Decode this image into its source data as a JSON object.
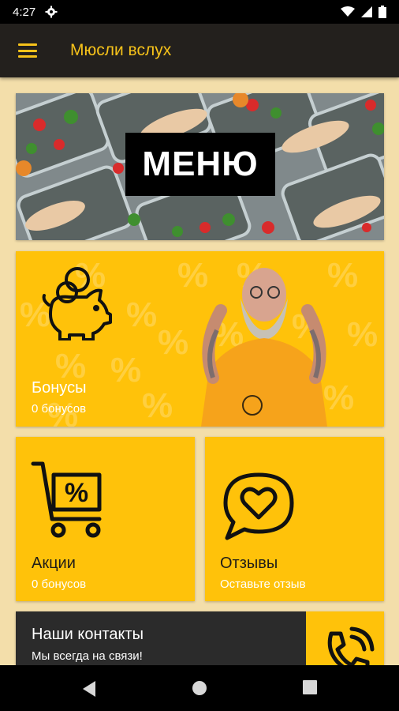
{
  "status": {
    "time": "4:27"
  },
  "appbar": {
    "title": "Мюсли вслух",
    "menu_icon": "hamburger-icon"
  },
  "menu_card": {
    "label": "МЕНЮ"
  },
  "bonus_card": {
    "title": "Бонусы",
    "subtitle": "0 бонусов",
    "icon": "piggy-bank-icon"
  },
  "promo_card": {
    "title": "Акции",
    "subtitle": "0 бонусов",
    "icon": "shopping-cart-percent-icon"
  },
  "review_card": {
    "title": "Отзывы",
    "subtitle": "Оставьте отзыв",
    "icon": "heart-speech-bubble-icon"
  },
  "contact_card": {
    "title": "Наши контакты",
    "subtitle": "Мы всегда на связи!",
    "icon": "phone-icon"
  },
  "colors": {
    "accent": "#ffc20a",
    "appbar": "#23201d",
    "background": "#f3deaa"
  }
}
